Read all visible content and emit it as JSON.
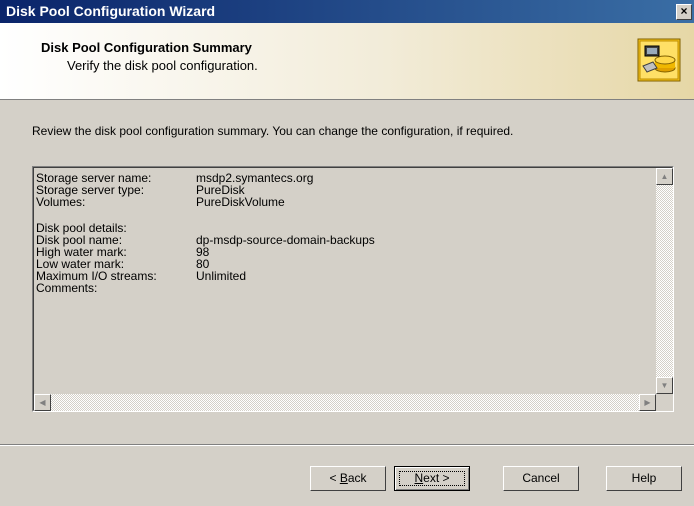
{
  "window": {
    "title": "Disk Pool Configuration Wizard",
    "close_icon": "close-icon"
  },
  "header": {
    "title": "Disk Pool Configuration Summary",
    "subtitle": "Verify the disk pool configuration.",
    "icon": "storage-wizard-icon"
  },
  "instruction": "Review the disk pool configuration summary. You can change the configuration, if required.",
  "summary": {
    "rows": [
      {
        "label": "Storage server name:",
        "value": "msdp2.symantecs.org"
      },
      {
        "label": "Storage server type:",
        "value": "PureDisk"
      },
      {
        "label": "Volumes:",
        "value": "PureDiskVolume"
      },
      {
        "label": "",
        "value": ""
      },
      {
        "label": "Disk pool details:",
        "value": ""
      },
      {
        "label": "Disk pool name:",
        "value": "dp-msdp-source-domain-backups"
      },
      {
        "label": "High water mark:",
        "value": "98"
      },
      {
        "label": "Low water mark:",
        "value": "80"
      },
      {
        "label": "Maximum I/O streams:",
        "value": "Unlimited"
      },
      {
        "label": "Comments:",
        "value": ""
      }
    ]
  },
  "buttons": {
    "back_prefix": "< ",
    "back_mnemonic": "B",
    "back_rest": "ack",
    "next_mnemonic": "N",
    "next_rest": "ext >",
    "cancel": "Cancel",
    "help": "Help"
  }
}
